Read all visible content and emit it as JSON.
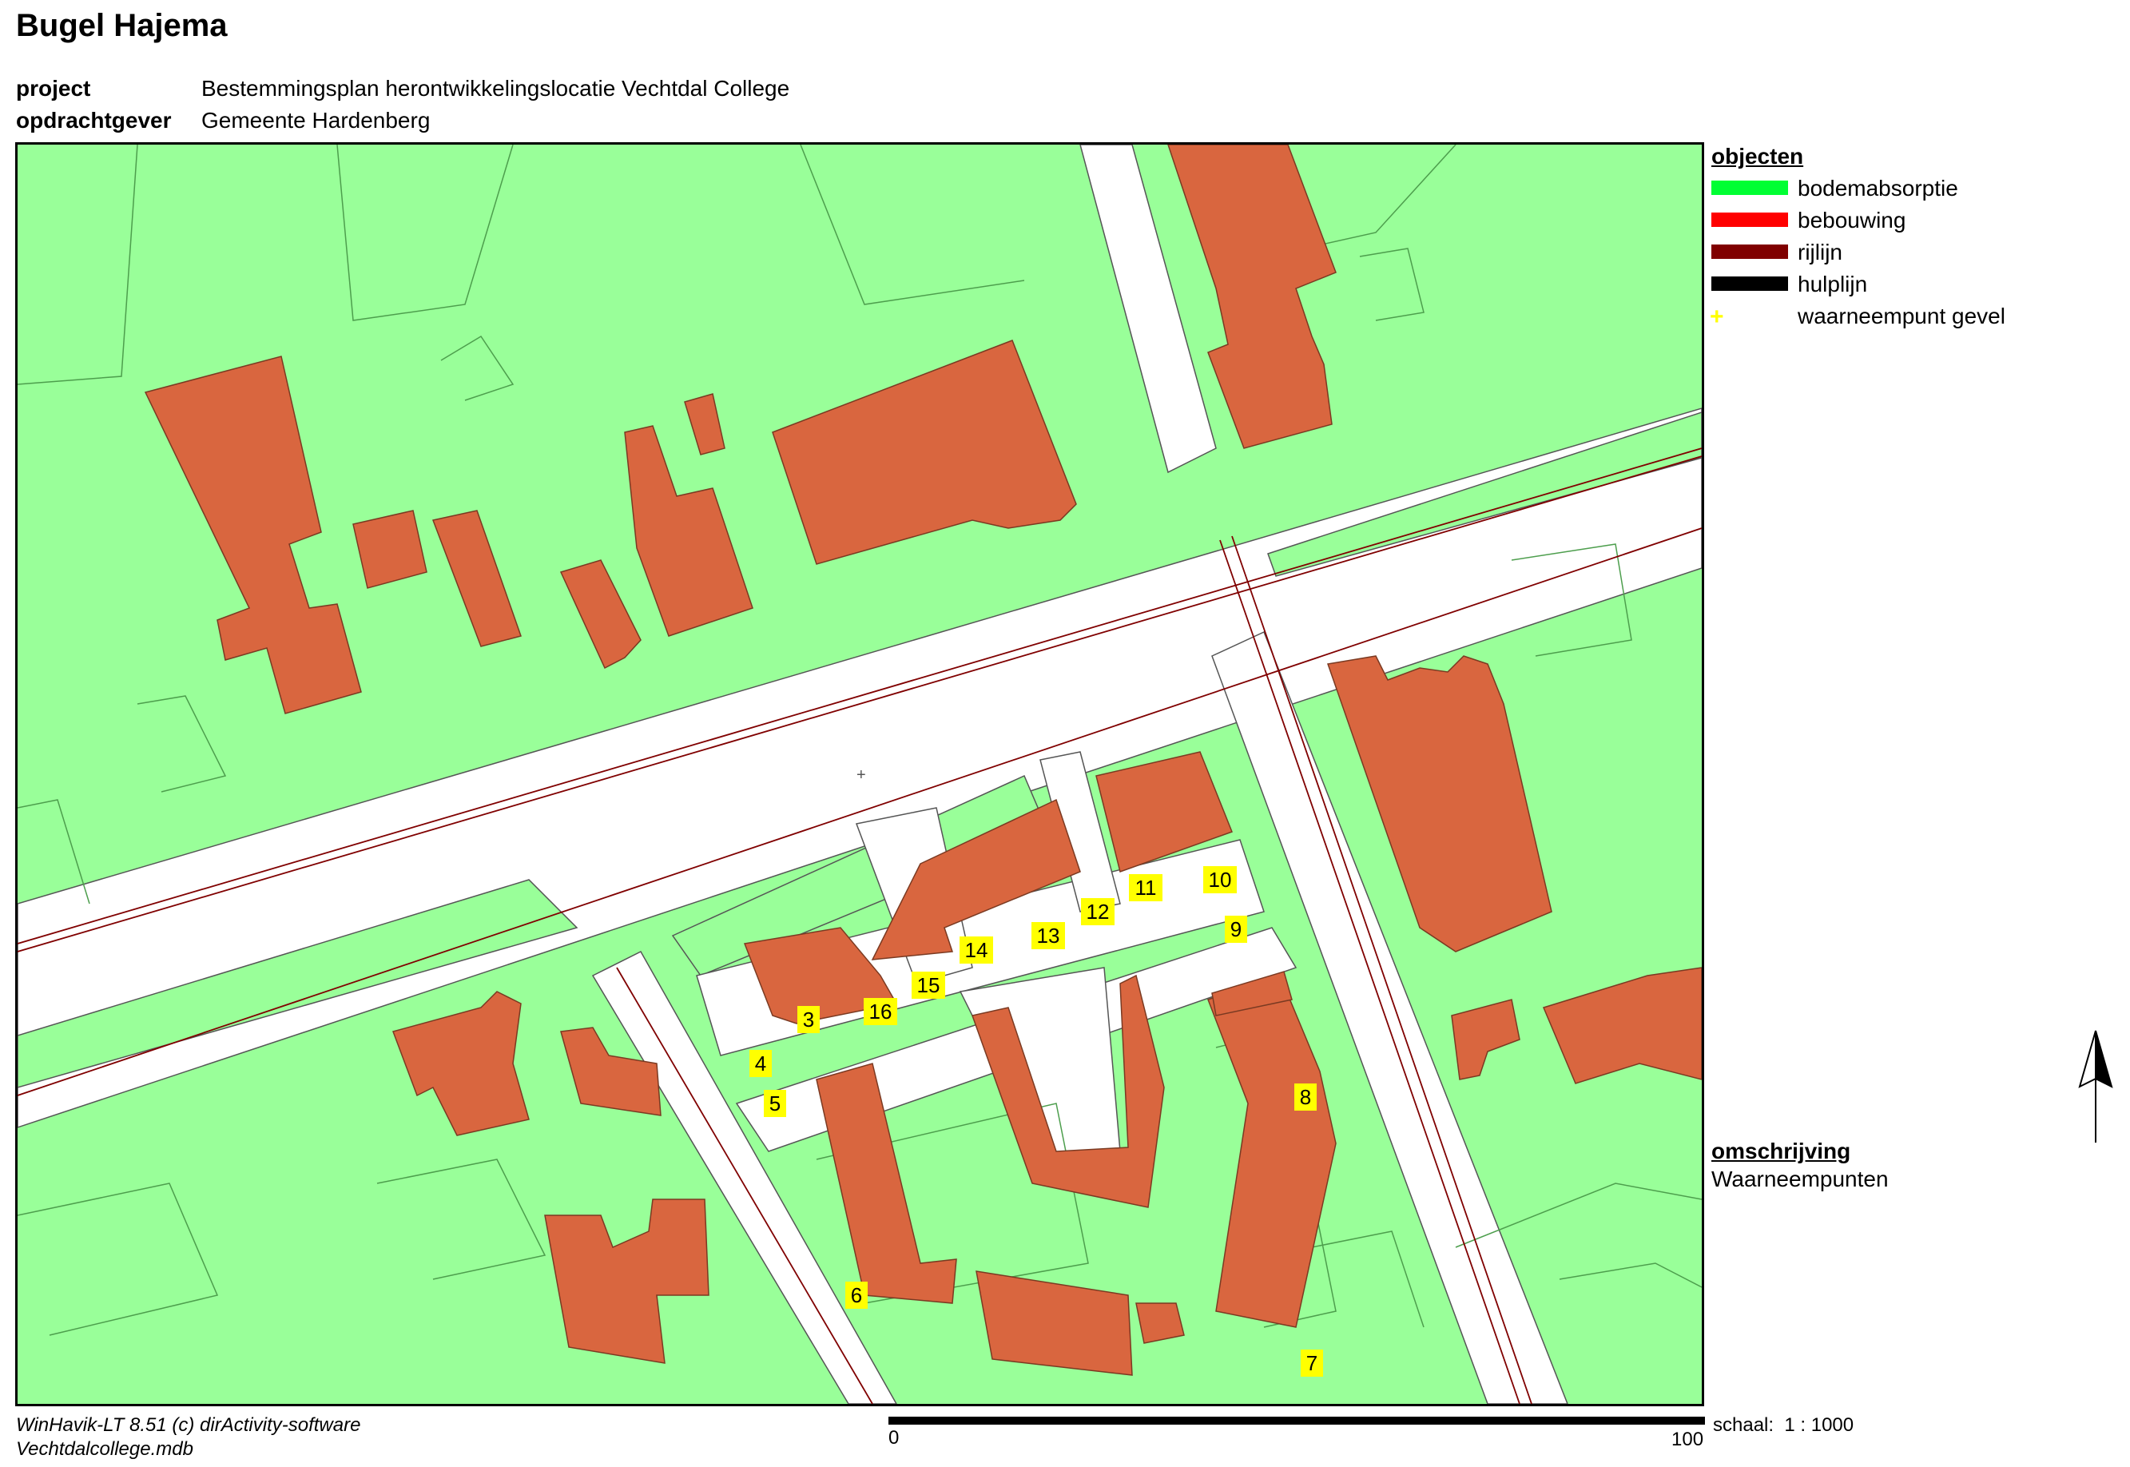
{
  "header": {
    "title": "Bugel Hajema",
    "project_label": "project",
    "project_value": "Bestemmingsplan herontwikkelingslocatie Vechtdal College",
    "client_label": "opdrachtgever",
    "client_value": "Gemeente Hardenberg"
  },
  "legend": {
    "heading": "objecten",
    "items": [
      {
        "label": "bodemabsorptie",
        "color": "#00ff33"
      },
      {
        "label": "bebouwing",
        "color": "#ff0000"
      },
      {
        "label": "rijlijn",
        "color": "#800000"
      },
      {
        "label": "hulplijn",
        "color": "#000000"
      },
      {
        "label": "waarneempunt gevel",
        "color": "#ffff00",
        "symbol": "+"
      }
    ]
  },
  "description": {
    "heading": "omschrijving",
    "value": "Waarneempunten"
  },
  "map": {
    "colors": {
      "ground": "#99ff99",
      "road": "#ffffff",
      "building": "#d9663f",
      "parcel_line": "#4d9e4d",
      "drive_line": "#800000",
      "marker": "#ffff00"
    },
    "north_arrow": "north-arrow-icon",
    "markers": [
      "3",
      "4",
      "5",
      "6",
      "7",
      "8",
      "9",
      "10",
      "11",
      "12",
      "13",
      "14",
      "15",
      "16"
    ]
  },
  "footer": {
    "software": "WinHavik-LT 8.51 (c) dirActivity-software",
    "file": "Vechtdalcollege.mdb",
    "scale_label": "schaal:  1 : 1000",
    "scale_start": "0",
    "scale_end": "100"
  }
}
